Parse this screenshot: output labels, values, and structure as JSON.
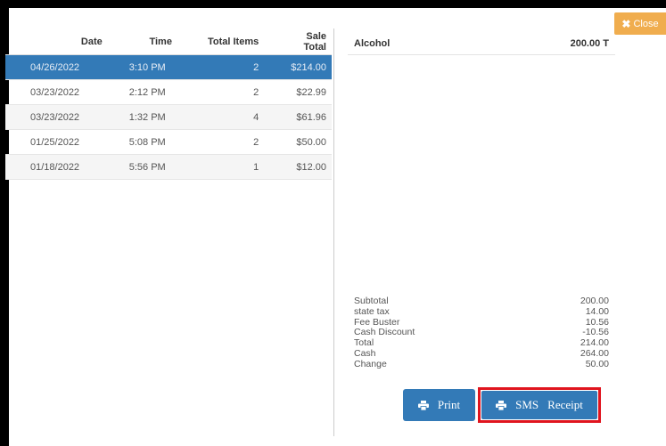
{
  "close_button": {
    "icon": "times-icon",
    "label": "Close"
  },
  "sales_table": {
    "headers": [
      "Date",
      "Time",
      "Total Items",
      "Sale Total"
    ],
    "rows": [
      [
        "04/26/2022",
        "3:10 PM",
        "2",
        "$214.00"
      ],
      [
        "03/23/2022",
        "2:12 PM",
        "2",
        "$22.99"
      ],
      [
        "03/23/2022",
        "1:32 PM",
        "4",
        "$61.96"
      ],
      [
        "01/25/2022",
        "5:08 PM",
        "2",
        "$50.00"
      ],
      [
        "01/18/2022",
        "5:56 PM",
        "1",
        "$12.00"
      ]
    ],
    "selected_index": 0
  },
  "detail": {
    "items": [
      {
        "name": "Alcohol",
        "amount": "200.00 T"
      }
    ],
    "totals": [
      {
        "label": "Subtotal",
        "value": "200.00"
      },
      {
        "label": "state tax",
        "value": "14.00"
      },
      {
        "label": "Fee Buster",
        "value": "10.56"
      },
      {
        "label": "Cash Discount",
        "value": "-10.56"
      },
      {
        "label": "Total",
        "value": "214.00"
      },
      {
        "label": "Cash",
        "value": "264.00"
      },
      {
        "label": "Change",
        "value": "50.00"
      }
    ]
  },
  "actions": {
    "print_label": "Print",
    "sms_label": "SMS",
    "receipt_label": "Receipt",
    "print_icon": "printer-icon"
  },
  "colors": {
    "primary": "#337ab7",
    "warning": "#f0ad4e",
    "highlight": "#e0141e"
  }
}
